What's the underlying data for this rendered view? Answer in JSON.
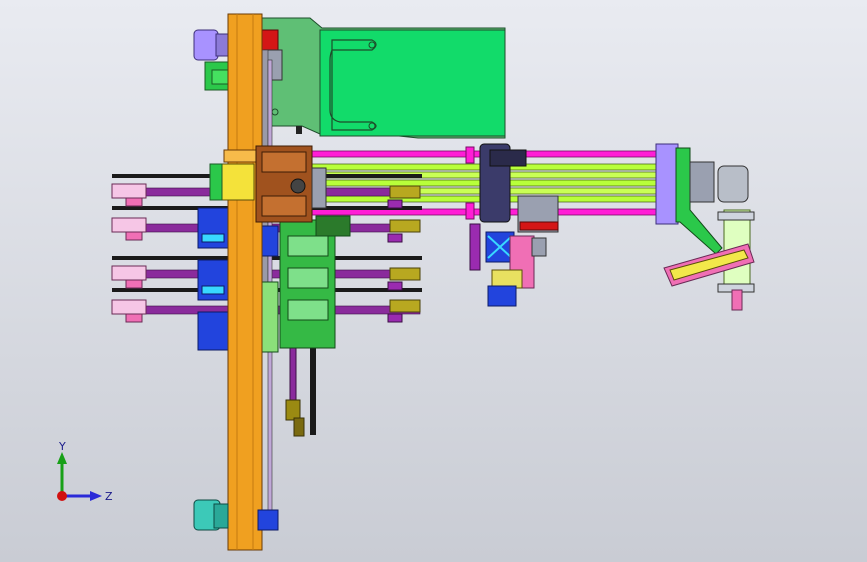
{
  "viewport": {
    "background_top": "#e9ebf1",
    "background_bottom": "#c9ccd4"
  },
  "colors": {
    "orange_frame": "#f0a020",
    "green_plate": "#12db6a",
    "magenta_rod": "#ff1dd6",
    "lime_rod": "#b8ff3a",
    "purple_rod": "#8a2b9c",
    "lavender_cap": "#a892ff",
    "teal_cap": "#3cc9b8",
    "blue_block": "#2244dd",
    "brown_block": "#a0521e",
    "olive_block": "#9a8a12",
    "pink_block": "#f06fb5"
  },
  "triad": {
    "y_label": "Y",
    "z_label": "Z",
    "y_axis_color": "#18a018",
    "z_axis_color": "#2a2ad8",
    "origin_color": "#d01010"
  }
}
